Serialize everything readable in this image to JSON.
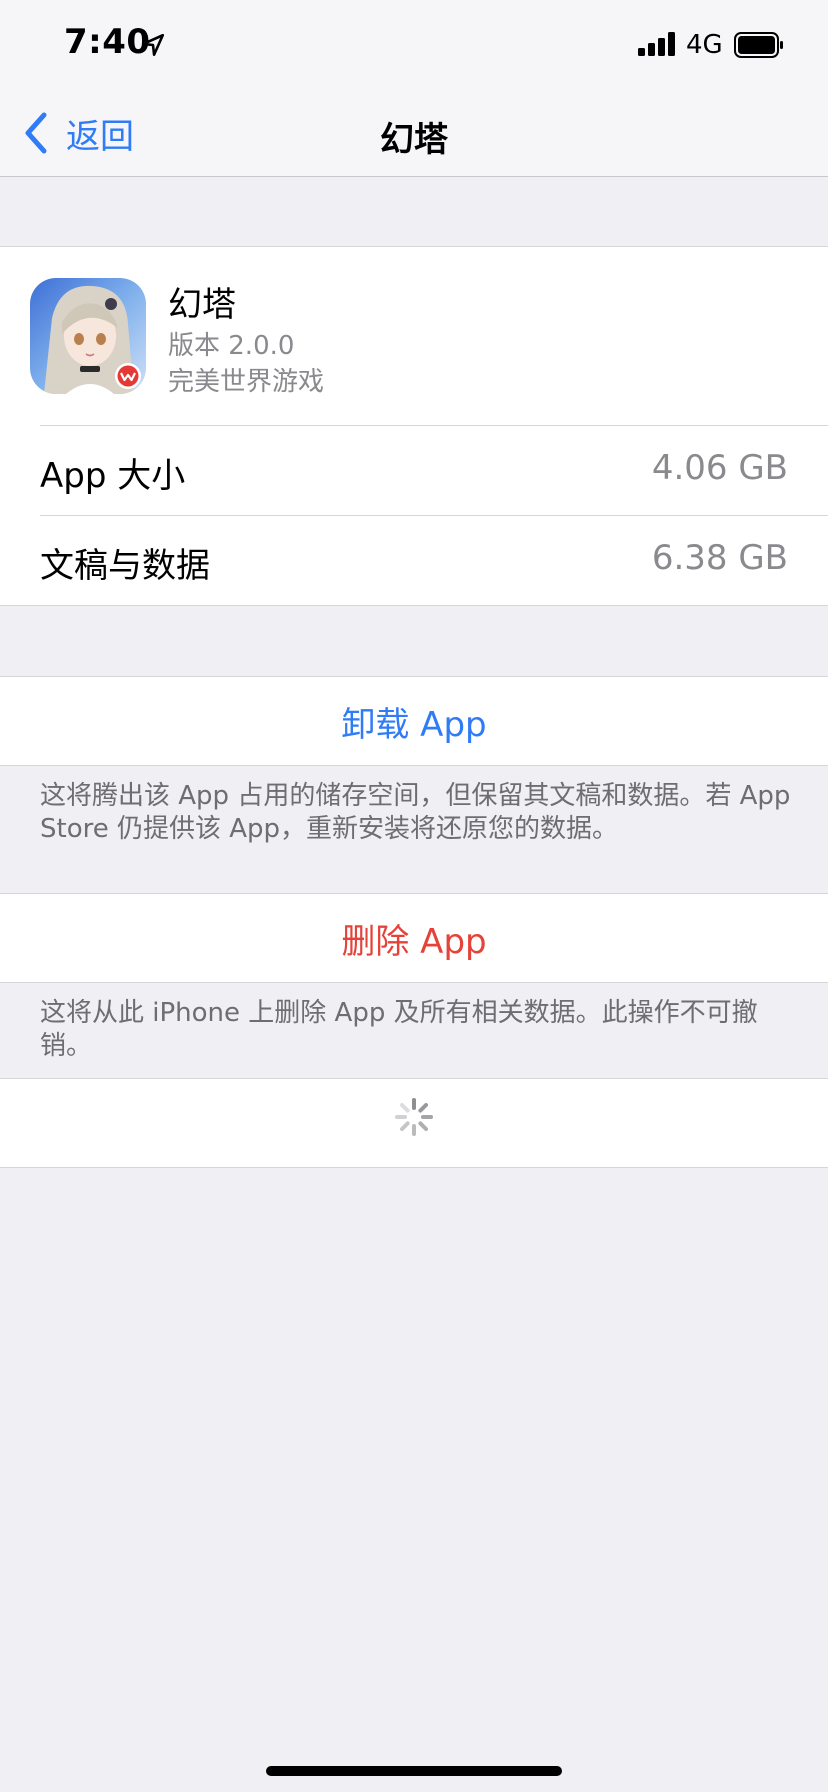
{
  "status_bar": {
    "time": "7:40",
    "network": "4G",
    "icons": [
      "location-arrow-icon",
      "cellular-signal-icon",
      "battery-icon"
    ]
  },
  "nav": {
    "back_label": "返回",
    "title": "幻塔"
  },
  "app": {
    "name": "幻塔",
    "version": "版本 2.0.0",
    "developer": "完美世界游戏",
    "icon": "app-icon-anime-character"
  },
  "storage": {
    "app_size_label": "App 大小",
    "app_size_value": "4.06 GB",
    "docs_label": "文稿与数据",
    "docs_value": "6.38 GB"
  },
  "offload": {
    "label": "卸载 App",
    "footnote": "这将腾出该 App 占用的储存空间，但保留其文稿和数据。若 App Store 仍提供该 App，重新安装将还原您的数据。"
  },
  "delete": {
    "label": "删除 App",
    "footnote": "这将从此 iPhone 上删除 App 及所有相关数据。此操作不可撤销。"
  },
  "colors": {
    "accent_blue": "#2f7cf6",
    "destructive_red": "#e5433a",
    "background": "#efeff4",
    "secondary_text": "#8a8a8e"
  }
}
